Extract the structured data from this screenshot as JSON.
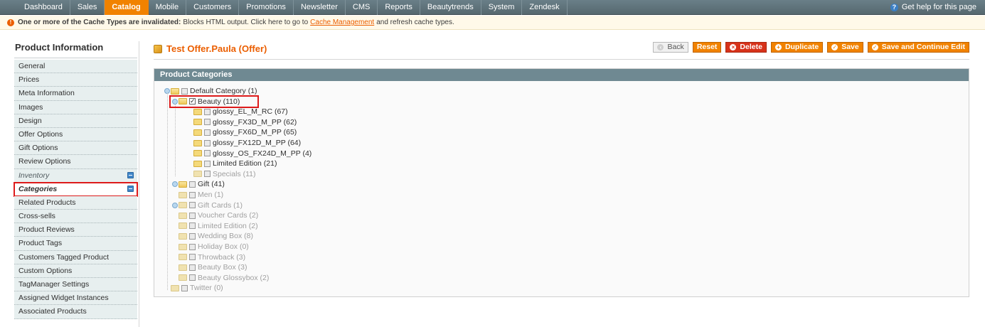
{
  "topnav": {
    "items": [
      {
        "label": "Dashboard",
        "active": false
      },
      {
        "label": "Sales",
        "active": false
      },
      {
        "label": "Catalog",
        "active": true
      },
      {
        "label": "Mobile",
        "active": false
      },
      {
        "label": "Customers",
        "active": false
      },
      {
        "label": "Promotions",
        "active": false
      },
      {
        "label": "Newsletter",
        "active": false
      },
      {
        "label": "CMS",
        "active": false
      },
      {
        "label": "Reports",
        "active": false
      },
      {
        "label": "Beautytrends",
        "active": false
      },
      {
        "label": "System",
        "active": false
      },
      {
        "label": "Zendesk",
        "active": false
      }
    ],
    "help_label": "Get help for this page"
  },
  "notice": {
    "bold": "One or more of the Cache Types are invalidated:",
    "text": "Blocks HTML output. Click here to go to",
    "link": "Cache Management",
    "suffix": "and refresh cache types."
  },
  "sidebar": {
    "title": "Product Information",
    "items": [
      {
        "label": "General"
      },
      {
        "label": "Prices"
      },
      {
        "label": "Meta Information"
      },
      {
        "label": "Images"
      },
      {
        "label": "Design"
      },
      {
        "label": "Offer Options"
      },
      {
        "label": "Gift Options"
      },
      {
        "label": "Review Options"
      },
      {
        "label": "Inventory",
        "italic": true,
        "icon": "disk-icon"
      },
      {
        "label": "Categories",
        "selected": true,
        "icon": "disk-icon"
      },
      {
        "label": "Related Products"
      },
      {
        "label": "Cross-sells"
      },
      {
        "label": "Product Reviews"
      },
      {
        "label": "Product Tags"
      },
      {
        "label": "Customers Tagged Product"
      },
      {
        "label": "Custom Options"
      },
      {
        "label": "TagManager Settings"
      },
      {
        "label": "Assigned Widget Instances"
      },
      {
        "label": "Associated Products"
      }
    ]
  },
  "main": {
    "title": "Test Offer.Paula (Offer)",
    "buttons": {
      "back": "Back",
      "reset": "Reset",
      "delete": "Delete",
      "duplicate": "Duplicate",
      "save": "Save",
      "save_continue": "Save and Continue Edit"
    },
    "panel_title": "Product Categories"
  },
  "tree": [
    {
      "label": "Default Category (1)",
      "level": 0,
      "expander": true,
      "checked": false,
      "disabled": false
    },
    {
      "label": "Beauty (110)",
      "level": 1,
      "expander": true,
      "checked": true,
      "disabled": false
    },
    {
      "label": "glossy_EL_M_RC (67)",
      "level": 2,
      "expander": false,
      "checked": false,
      "disabled": false
    },
    {
      "label": "glossy_FX3D_M_PP (62)",
      "level": 2,
      "expander": false,
      "checked": false,
      "disabled": false
    },
    {
      "label": "glossy_FX6D_M_PP (65)",
      "level": 2,
      "expander": false,
      "checked": false,
      "disabled": false
    },
    {
      "label": "glossy_FX12D_M_PP (64)",
      "level": 2,
      "expander": false,
      "checked": false,
      "disabled": false
    },
    {
      "label": "glossy_OS_FX24D_M_PP (4)",
      "level": 2,
      "expander": false,
      "checked": false,
      "disabled": false
    },
    {
      "label": "Limited Edition (21)",
      "level": 2,
      "expander": false,
      "checked": false,
      "disabled": false
    },
    {
      "label": "Specials (11)",
      "level": 2,
      "expander": false,
      "checked": false,
      "disabled": true
    },
    {
      "label": "Gift (41)",
      "level": 1,
      "expander": true,
      "checked": false,
      "disabled": false
    },
    {
      "label": "Men (1)",
      "level": 1,
      "expander": false,
      "checked": false,
      "disabled": true
    },
    {
      "label": "Gift Cards (1)",
      "level": 1,
      "expander": true,
      "checked": false,
      "disabled": true
    },
    {
      "label": "Voucher Cards (2)",
      "level": 1,
      "expander": false,
      "checked": false,
      "disabled": true
    },
    {
      "label": "Limited Edition (2)",
      "level": 1,
      "expander": false,
      "checked": false,
      "disabled": true
    },
    {
      "label": "Wedding Box (8)",
      "level": 1,
      "expander": false,
      "checked": false,
      "disabled": true
    },
    {
      "label": "Holiday Box (0)",
      "level": 1,
      "expander": false,
      "checked": false,
      "disabled": true
    },
    {
      "label": "Throwback (3)",
      "level": 1,
      "expander": false,
      "checked": false,
      "disabled": true
    },
    {
      "label": "Beauty Box (3)",
      "level": 1,
      "expander": false,
      "checked": false,
      "disabled": true
    },
    {
      "label": "Beauty Glossybox (2)",
      "level": 1,
      "expander": false,
      "checked": false,
      "disabled": true
    },
    {
      "label": "Twitter (0)",
      "level": 0,
      "expander": false,
      "checked": false,
      "disabled": true
    }
  ]
}
